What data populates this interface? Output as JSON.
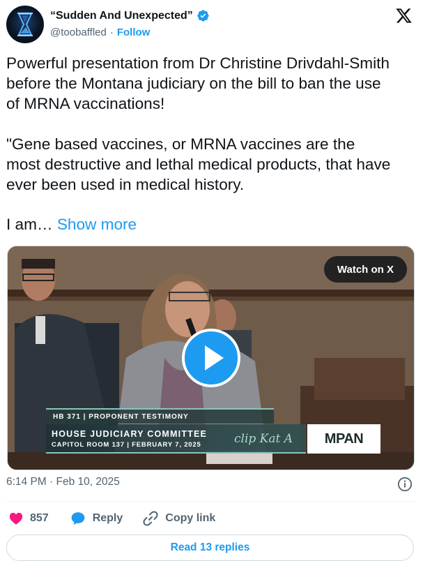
{
  "author": {
    "display_name": "“Sudden And Unexpected”",
    "handle": "@toobaffled",
    "separator": "·",
    "follow_label": "Follow",
    "verified": true
  },
  "tweet": {
    "text": "Powerful presentation from Dr Christine Drivdahl-Smith\nbefore the Montana judiciary on the bill to ban the use\nof MRNA vaccinations!\n\n\"Gene based vaccines, or MRNA  vaccines are the\nmost destructive and lethal medical products, that have\never been used in medical history.",
    "truncated_text": "I  am…",
    "show_more_label": "Show more"
  },
  "media": {
    "watch_label": "Watch on X",
    "lower_third": {
      "bill": "HB 371 | PROPONENT TESTIMONY",
      "committee": "HOUSE JUDICIARY COMMITTEE",
      "room": "CAPITOL ROOM 137 | FEBRUARY 7, 2025",
      "clip": "clip Kat A",
      "network": "MPAN"
    }
  },
  "meta": {
    "timestamp": "6:14 PM · Feb 10, 2025"
  },
  "actions": {
    "likes_count": "857",
    "reply_label": "Reply",
    "copy_link_label": "Copy link"
  },
  "footer": {
    "read_replies_label": "Read 13 replies"
  },
  "colors": {
    "accent": "#1d9bf0",
    "like": "#f91880",
    "text": "#0f1419",
    "muted": "#536471"
  },
  "icons": [
    "avatar-hourglass-icon",
    "verified-badge-icon",
    "x-logo-icon",
    "play-icon",
    "info-icon",
    "heart-icon",
    "reply-bubble-icon",
    "link-icon"
  ]
}
